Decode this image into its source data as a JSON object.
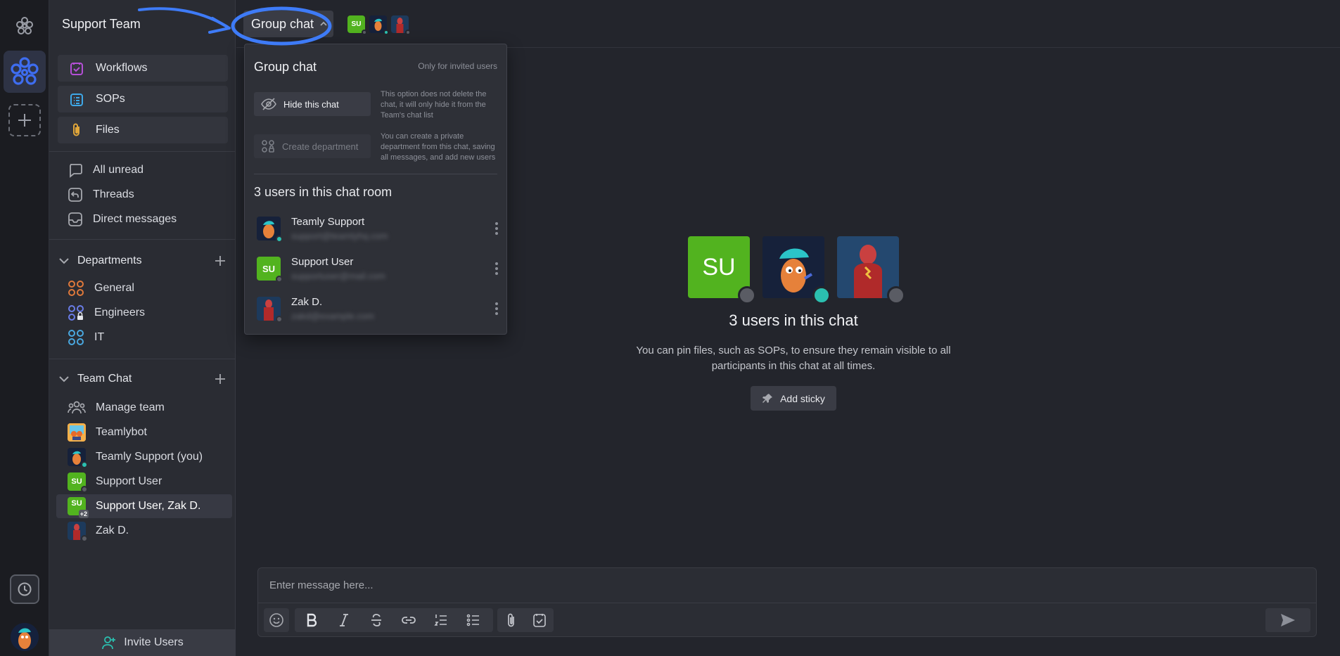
{
  "sidebar": {
    "team_name": "Support Team",
    "quick_links": [
      {
        "label": "Workflows",
        "icon": "workflow-icon"
      },
      {
        "label": "SOPs",
        "icon": "clipboard-list-icon"
      },
      {
        "label": "Files",
        "icon": "paperclip-icon"
      }
    ],
    "nav": [
      {
        "label": "All unread",
        "icon": "chat-bubble-icon"
      },
      {
        "label": "Threads",
        "icon": "reply-icon"
      },
      {
        "label": "Direct messages",
        "icon": "inbox-icon"
      }
    ],
    "departments": {
      "title": "Departments",
      "items": [
        {
          "label": "General",
          "color": "#e0793b"
        },
        {
          "label": "Engineers",
          "color": "#6a7de8"
        },
        {
          "label": "IT",
          "color": "#4aa8e0"
        }
      ]
    },
    "team_chat": {
      "title": "Team Chat",
      "items": [
        {
          "label": "Manage team"
        },
        {
          "label": "Teamlybot"
        },
        {
          "label": "Teamly Support (you)"
        },
        {
          "label": "Support User",
          "initials": "SU"
        },
        {
          "label": "Support User, Zak D.",
          "initials": "SU",
          "badge": "+2"
        },
        {
          "label": "Zak D."
        }
      ]
    },
    "invite_label": "Invite Users"
  },
  "header": {
    "chat_selector_label": "Group chat",
    "member_initials": "SU"
  },
  "dropdown": {
    "title": "Group chat",
    "visibility_note": "Only for invited users",
    "hide_label": "Hide this chat",
    "hide_desc": "This option does not delete the chat, it will only hide it from the Team's chat list",
    "create_label": "Create department",
    "create_desc": "You can create a private department from this chat, saving all messages, and add new users",
    "users_title": "3 users in this chat room",
    "users": [
      {
        "name": "Teamly Support",
        "email": "support@teamlyhq.com",
        "status": "online"
      },
      {
        "name": "Support User",
        "initials": "SU",
        "email": "supportuser@mail.com",
        "status": "offline"
      },
      {
        "name": "Zak D.",
        "email": "zakd@example.com",
        "status": "offline"
      }
    ]
  },
  "main": {
    "big_initials": "SU",
    "users_title": "3 users in this chat",
    "description": "You can pin files, such as SOPs, to ensure they remain visible to all participants in this chat at all times.",
    "sticky_label": "Add sticky"
  },
  "composer": {
    "placeholder": "Enter message here...",
    "tools": [
      "emoji-icon",
      "bold-icon",
      "italic-icon",
      "strikethrough-icon",
      "link-icon",
      "ordered-list-icon",
      "bullet-list-icon",
      "attach-icon",
      "task-icon"
    ]
  },
  "colors": {
    "accent": "#3e6df0",
    "online": "#2bc0b0",
    "su_green": "#52b31f"
  }
}
